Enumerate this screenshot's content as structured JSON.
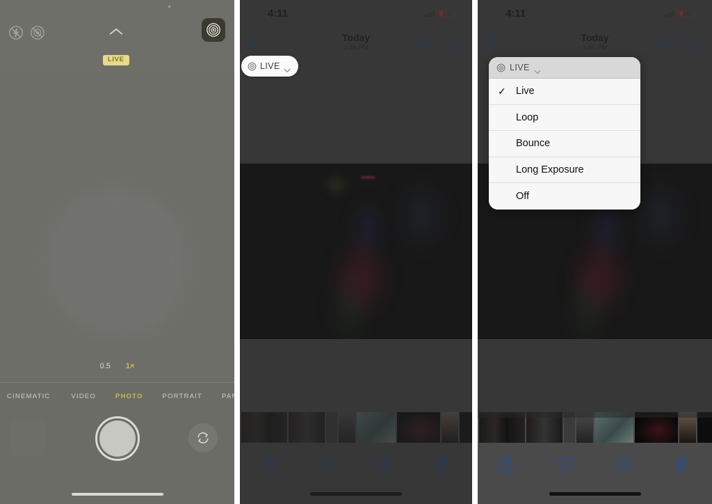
{
  "layout": {
    "panel_count": 3,
    "background": "#ffffff"
  },
  "colors": {
    "accent_blue": "#1f4f96",
    "camera_yellow": "#dfc758",
    "live_badge_bg": "#e8d98b",
    "live_badge_text": "#7e7526",
    "battery_red": "#c0392b",
    "camera_bg": "#6e6e68",
    "photo_bg": "#050505",
    "menu_bg": "#f7f7f7"
  },
  "camera_panel": {
    "name": "Camera app",
    "flash_icon": "flash-off-icon",
    "live_off_icon": "live-photo-off-icon",
    "chevron_icon": "chevron-up-icon",
    "live_badge": "LIVE",
    "live_toggle_icon": "live-photo-on-icon",
    "zoom_options": [
      {
        "label": "0.5",
        "active": false
      },
      {
        "label": "1×",
        "active": true
      }
    ],
    "modes": [
      {
        "label": "CINEMATIC",
        "active": false
      },
      {
        "label": "VIDEO",
        "active": false
      },
      {
        "label": "PHOTO",
        "active": true
      },
      {
        "label": "PORTRAIT",
        "active": false
      },
      {
        "label": "PANO",
        "active": false
      }
    ],
    "shutter_name": "shutter-button",
    "flip_icon": "camera-flip-icon",
    "thumbnail_name": "last-photo-thumbnail"
  },
  "photos_panel": {
    "name": "Photos app detail view",
    "status": {
      "time": "4:11",
      "signal_icon": "cellular-signal-icon",
      "battery_icon": "battery-low-icon"
    },
    "nav": {
      "back_icon": "chevron-left-icon",
      "title": "Today",
      "subtitle": "1:35 PM",
      "edit_label": "Edit",
      "more_icon": "more-ellipsis-icon"
    },
    "live_pill": {
      "icon": "live-photo-target-icon",
      "label": "LIVE",
      "chevron_icon": "chevron-down-icon"
    },
    "toolbar": [
      {
        "name": "share-icon"
      },
      {
        "name": "heart-icon"
      },
      {
        "name": "info-icon"
      },
      {
        "name": "trash-icon"
      }
    ],
    "filmstrip_thumb_widths": [
      66,
      52,
      16,
      24,
      56,
      62,
      24,
      36,
      36,
      32
    ]
  },
  "menu_panel": {
    "name": "Photos app with Live Photo effects menu open",
    "dropdown": {
      "header_icon": "live-photo-target-icon",
      "header_label": "LIVE",
      "header_chevron_icon": "chevron-down-icon",
      "items": [
        {
          "label": "Live",
          "checked": true
        },
        {
          "label": "Loop",
          "checked": false
        },
        {
          "label": "Bounce",
          "checked": false
        },
        {
          "label": "Long Exposure",
          "checked": false
        },
        {
          "label": "Off",
          "checked": false
        }
      ],
      "check_glyph": "✓"
    }
  }
}
